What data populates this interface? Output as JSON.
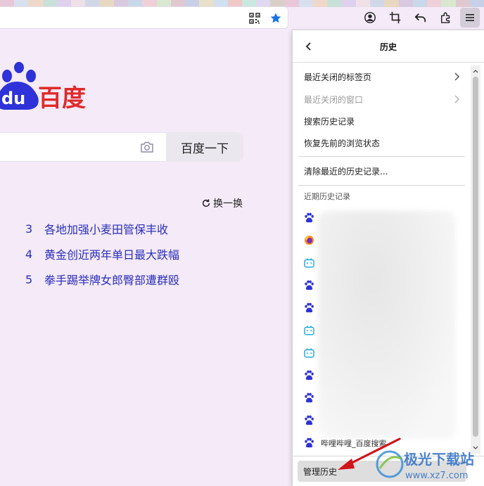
{
  "toolbar": {
    "icons": [
      "qr-code-icon",
      "bookmark-star-icon",
      "account-icon",
      "screenshot-icon",
      "undo-icon",
      "extensions-icon",
      "menu-icon"
    ],
    "accent": "#1a73e8"
  },
  "baidu": {
    "logo_text": "百度",
    "logo_du": "du",
    "logo_red": "#e02a2a",
    "logo_blue": "#2e32d8",
    "search_button": "百度一下",
    "search_placeholder": "",
    "refresh_label": "换一换",
    "hot_items": [
      {
        "num": "3",
        "title": "各地加强小麦田管保丰收"
      },
      {
        "num": "4",
        "title": "黄金创近两年单日最大跌幅"
      },
      {
        "num": "5",
        "title": "拳手踢举牌女郎臀部遭群殴"
      }
    ]
  },
  "history_panel": {
    "title": "历史",
    "menu": [
      {
        "label": "最近关闭的标签页",
        "submenu": true,
        "disabled": false
      },
      {
        "label": "最近关闭的窗口",
        "submenu": true,
        "disabled": true
      },
      {
        "label": "搜索历史记录",
        "submenu": false,
        "disabled": false
      },
      {
        "label": "恢复先前的浏览状态",
        "submenu": false,
        "disabled": false
      }
    ],
    "clear_label": "清除最近的历史记录...",
    "recent_label": "近期历史记录",
    "recent_icons": [
      "baidu-icon",
      "firefox-icon",
      "bilibili-icon",
      "baidu-icon",
      "baidu-icon",
      "bilibili-icon",
      "bilibili-icon",
      "baidu-icon",
      "baidu-icon",
      "baidu-icon",
      "baidu-icon"
    ],
    "last_item_label": "哔哩哔哩_百度搜索",
    "manage_label": "管理历史"
  },
  "watermark": {
    "text": "极光下载站",
    "url": "www.xz7.com"
  }
}
